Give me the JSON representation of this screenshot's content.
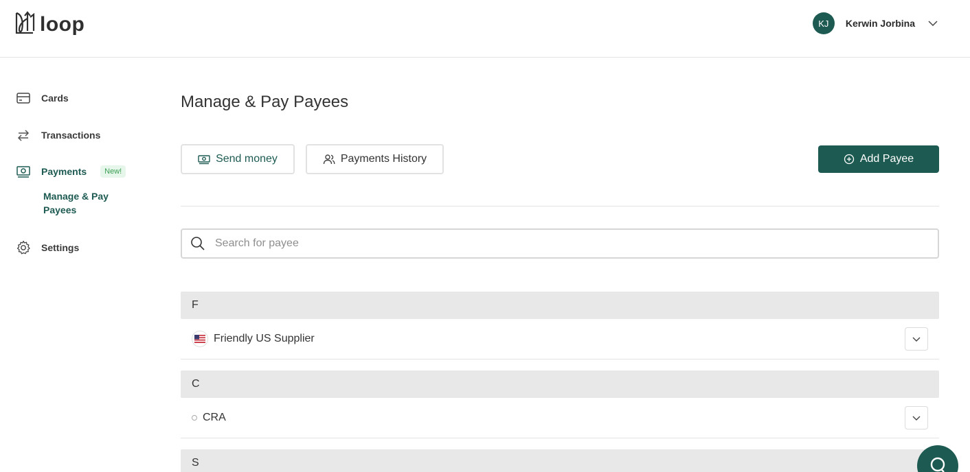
{
  "app": {
    "logo_text": "loop"
  },
  "user": {
    "initials": "KJ",
    "name": "Kerwin Jorbina",
    "menu_icon": "chevron-down-icon"
  },
  "sidebar": {
    "items": [
      {
        "label": "Cards",
        "icon": "credit-card-icon"
      },
      {
        "label": "Transactions",
        "icon": "swap-arrows-icon"
      },
      {
        "label": "Payments",
        "icon": "payments-icon",
        "badge": "New!"
      },
      {
        "label": "Settings",
        "icon": "gear-icon"
      }
    ],
    "sub_item": "Manage & Pay Payees"
  },
  "main": {
    "title": "Manage & Pay Payees",
    "send_money_label": "Send money",
    "history_label": "Payments History",
    "add_payee_label": "Add Payee",
    "search_placeholder": "Search for payee",
    "groups": [
      {
        "letter": "F",
        "payees": [
          {
            "name": "Friendly US Supplier",
            "icon": "us-flag-icon"
          }
        ]
      },
      {
        "letter": "C",
        "payees": [
          {
            "name": "CRA",
            "icon": "circle-icon"
          }
        ]
      },
      {
        "letter": "S",
        "payees": []
      }
    ]
  },
  "colors": {
    "brand": "#1d5a52",
    "badge_bg": "#e7f6ea",
    "badge_text": "#3b9e55",
    "group_bg": "#e8e8e8"
  }
}
